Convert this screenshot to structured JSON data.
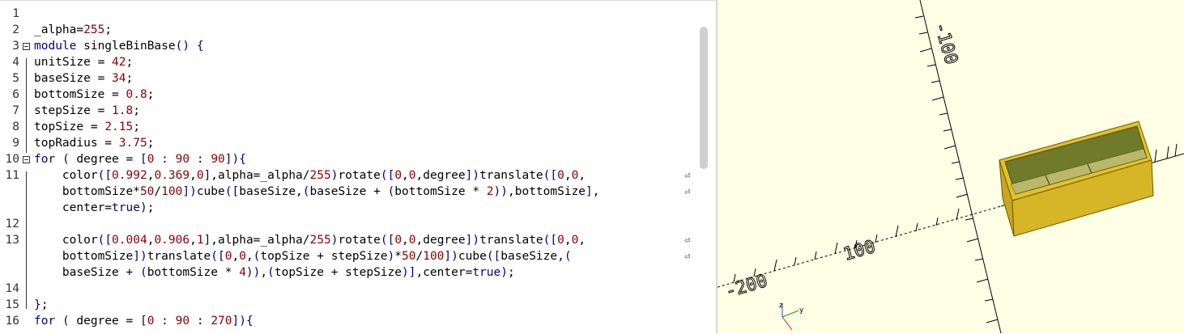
{
  "editor": {
    "lines": [
      {
        "n": "1",
        "text": ""
      },
      {
        "n": "2",
        "text": "_alpha=255;"
      },
      {
        "n": "3",
        "text": "module singleBinBase() {"
      },
      {
        "n": "4",
        "text": "unitSize = 42;"
      },
      {
        "n": "5",
        "text": "baseSize = 34;"
      },
      {
        "n": "6",
        "text": "bottomSize = 0.8;"
      },
      {
        "n": "7",
        "text": "stepSize = 1.8;"
      },
      {
        "n": "8",
        "text": "topSize = 2.15;"
      },
      {
        "n": "9",
        "text": "topRadius = 3.75;"
      },
      {
        "n": "10",
        "text": "for ( degree = [0 : 90 : 90]){"
      },
      {
        "n": "11",
        "text": "    color([0.992,0.369,0],alpha=_alpha/255)rotate([0,0,degree])translate([0,0,"
      },
      {
        "n": "",
        "text": "    bottomSize*50/100])cube([baseSize,(baseSize + (bottomSize * 2)),bottomSize],"
      },
      {
        "n": "",
        "text": "    center=true);"
      },
      {
        "n": "12",
        "text": ""
      },
      {
        "n": "13",
        "text": "    color([0.004,0.906,1],alpha=_alpha/255)rotate([0,0,degree])translate([0,0,"
      },
      {
        "n": "",
        "text": "    bottomSize])translate([0,0,(topSize + stepSize)*50/100])cube([baseSize,("
      },
      {
        "n": "",
        "text": "    baseSize + (bottomSize * 4)),(topSize + stepSize)],center=true);"
      },
      {
        "n": "14",
        "text": ""
      },
      {
        "n": "15",
        "text": "};"
      },
      {
        "n": "16",
        "text": "for ( degree = [0 : 90 : 270]){"
      }
    ],
    "wrap_glyph": "⏎"
  },
  "viewer": {
    "axis_labels": [
      "-100",
      "-200",
      "100"
    ],
    "background_color": "#ffffe5",
    "model_color": "#f2d02a",
    "axis_indicator": {
      "x": "x",
      "y": "y",
      "z": "z"
    }
  }
}
